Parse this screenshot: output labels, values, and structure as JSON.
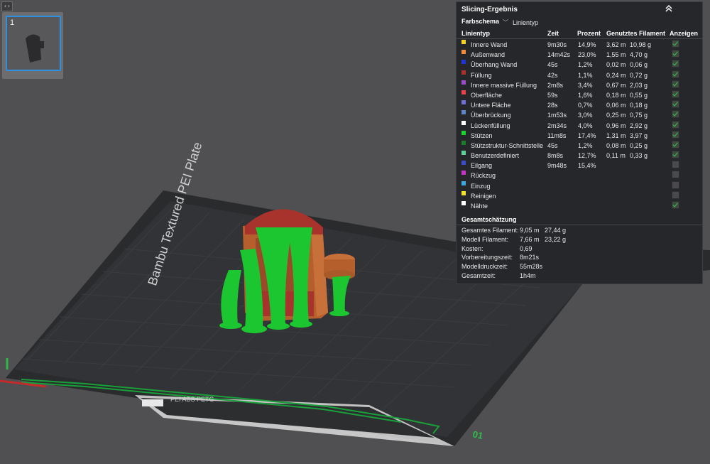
{
  "plate": {
    "thumbnail_number": "1",
    "plate_label": "Bambu Textured PEI Plate",
    "material_strip": "PEI ABS PETG",
    "plate_code": "01"
  },
  "result": {
    "title": "Slicing-Ergebnis",
    "color_scheme_label": "Farbschema",
    "color_scheme_value": "Linientyp",
    "columns": {
      "type": "Linientyp",
      "time": "Zeit",
      "percent": "Prozent",
      "filament": "Genutztes Filament",
      "show": "Anzeigen"
    },
    "rows": [
      {
        "name": "Innere Wand",
        "color": "#f5d22a",
        "time": "9m30s",
        "percent": "14,9%",
        "meters": "3,62 m",
        "grams": "10,98 g",
        "shown": true
      },
      {
        "name": "Außenwand",
        "color": "#f28a3c",
        "time": "14m42s",
        "percent": "23,0%",
        "meters": "1,55 m",
        "grams": "4,70 g",
        "shown": true
      },
      {
        "name": "Überhang Wand",
        "color": "#2233d6",
        "time": "45s",
        "percent": "1,2%",
        "meters": "0,02 m",
        "grams": "0,06 g",
        "shown": true
      },
      {
        "name": "Füllung",
        "color": "#a8332c",
        "time": "42s",
        "percent": "1,1%",
        "meters": "0,24 m",
        "grams": "0,72 g",
        "shown": true
      },
      {
        "name": "Innere massive Füllung",
        "color": "#9a4fc6",
        "time": "2m8s",
        "percent": "3,4%",
        "meters": "0,67 m",
        "grams": "2,03 g",
        "shown": true
      },
      {
        "name": "Oberfläche",
        "color": "#e8434a",
        "time": "59s",
        "percent": "1,6%",
        "meters": "0,18 m",
        "grams": "0,55 g",
        "shown": true
      },
      {
        "name": "Untere Fläche",
        "color": "#6f6fd6",
        "time": "28s",
        "percent": "0,7%",
        "meters": "0,06 m",
        "grams": "0,18 g",
        "shown": true
      },
      {
        "name": "Überbrückung",
        "color": "#5e86c6",
        "time": "1m53s",
        "percent": "3,0%",
        "meters": "0,25 m",
        "grams": "0,75 g",
        "shown": true
      },
      {
        "name": "Lückenfüllung",
        "color": "#ffffff",
        "time": "2m34s",
        "percent": "4,0%",
        "meters": "0,96 m",
        "grams": "2,92 g",
        "shown": true
      },
      {
        "name": "Stützen",
        "color": "#19d22c",
        "time": "11m8s",
        "percent": "17,4%",
        "meters": "1,31 m",
        "grams": "3,97 g",
        "shown": true
      },
      {
        "name": "Stützstruktur-Schnittstelle",
        "color": "#1b7d2a",
        "time": "45s",
        "percent": "1,2%",
        "meters": "0,08 m",
        "grams": "0,25 g",
        "shown": true
      },
      {
        "name": "Benutzerdefiniert",
        "color": "#5fcf9a",
        "time": "8m8s",
        "percent": "12,7%",
        "meters": "0,11 m",
        "grams": "0,33 g",
        "shown": true
      },
      {
        "name": "Eilgang",
        "color": "#3a4dc8",
        "time": "9m48s",
        "percent": "15,4%",
        "meters": "",
        "grams": "",
        "shown": false
      },
      {
        "name": "Rückzug",
        "color": "#c631c6",
        "time": "",
        "percent": "",
        "meters": "",
        "grams": "",
        "shown": false
      },
      {
        "name": "Einzug",
        "color": "#3fa6e0",
        "time": "",
        "percent": "",
        "meters": "",
        "grams": "",
        "shown": false
      },
      {
        "name": "Reinigen",
        "color": "#f5e12a",
        "time": "",
        "percent": "",
        "meters": "",
        "grams": "",
        "shown": false
      },
      {
        "name": "Nähte",
        "color": "#ffffff",
        "time": "",
        "percent": "",
        "meters": "",
        "grams": "",
        "shown": true
      }
    ],
    "summary_title": "Gesamtschätzung",
    "summary": [
      {
        "label": "Gesamtes Filament:",
        "v1": "9,05 m",
        "v2": "27,44 g"
      },
      {
        "label": "Modell Filament:",
        "v1": "7,66 m",
        "v2": "23,22 g"
      },
      {
        "label": "Kosten:",
        "v1": "0,69",
        "v2": ""
      },
      {
        "label": "Vorbereitungszeit:",
        "v1": "8m21s",
        "v2": ""
      },
      {
        "label": "Modelldruckzeit:",
        "v1": "55m28s",
        "v2": ""
      },
      {
        "label": "Gesamtzeit:",
        "v1": "1h4m",
        "v2": ""
      }
    ]
  }
}
